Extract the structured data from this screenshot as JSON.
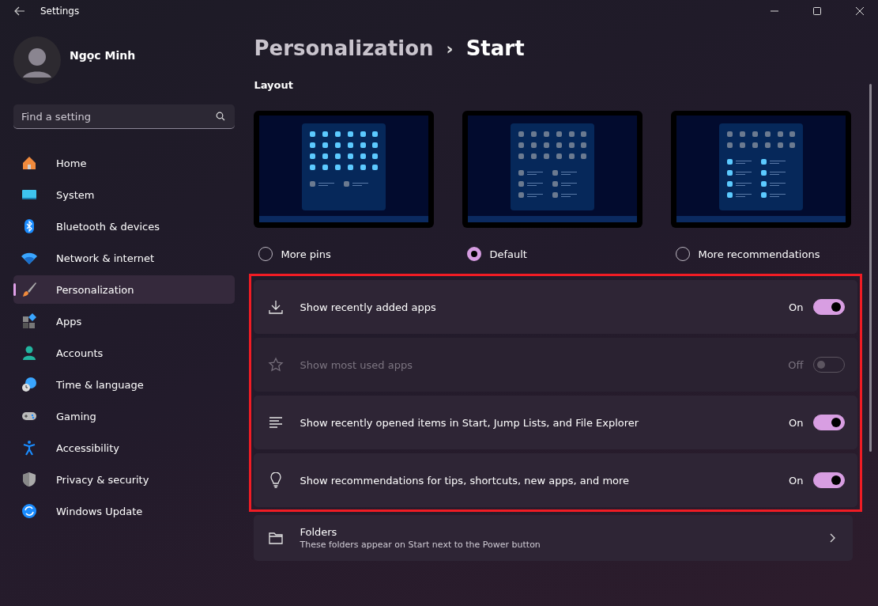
{
  "window": {
    "title": "Settings"
  },
  "profile": {
    "name": "Ngọc Minh"
  },
  "search": {
    "placeholder": "Find a setting"
  },
  "sidebar": {
    "items": [
      {
        "label": "Home",
        "kind": "home",
        "selected": false
      },
      {
        "label": "System",
        "kind": "system",
        "selected": false
      },
      {
        "label": "Bluetooth & devices",
        "kind": "bluetooth",
        "selected": false
      },
      {
        "label": "Network & internet",
        "kind": "network",
        "selected": false
      },
      {
        "label": "Personalization",
        "kind": "brush",
        "selected": true
      },
      {
        "label": "Apps",
        "kind": "apps",
        "selected": false
      },
      {
        "label": "Accounts",
        "kind": "accounts",
        "selected": false
      },
      {
        "label": "Time & language",
        "kind": "time",
        "selected": false
      },
      {
        "label": "Gaming",
        "kind": "gaming",
        "selected": false
      },
      {
        "label": "Accessibility",
        "kind": "accessibility",
        "selected": false
      },
      {
        "label": "Privacy & security",
        "kind": "privacy",
        "selected": false
      },
      {
        "label": "Windows Update",
        "kind": "update",
        "selected": false
      }
    ]
  },
  "breadcrumb": {
    "parent": "Personalization",
    "separator": "›",
    "current": "Start"
  },
  "layout": {
    "heading": "Layout",
    "options": [
      {
        "label": "More pins",
        "kind": "more_pins",
        "selected": false
      },
      {
        "label": "Default",
        "kind": "default",
        "selected": true
      },
      {
        "label": "More recommendations",
        "kind": "more_recommendations",
        "selected": false
      }
    ]
  },
  "toggles": [
    {
      "label": "Show recently added apps",
      "kind": "download",
      "on": true,
      "disabled": false,
      "state_text": "On"
    },
    {
      "label": "Show most used apps",
      "kind": "star",
      "on": false,
      "disabled": true,
      "state_text": "Off"
    },
    {
      "label": "Show recently opened items in Start, Jump Lists, and File Explorer",
      "kind": "lines",
      "on": true,
      "disabled": false,
      "state_text": "On"
    },
    {
      "label": "Show recommendations for tips, shortcuts, new apps, and more",
      "kind": "bulb",
      "on": true,
      "disabled": false,
      "state_text": "On"
    }
  ],
  "folders": {
    "title": "Folders",
    "description": "These folders appear on Start next to the Power button"
  }
}
